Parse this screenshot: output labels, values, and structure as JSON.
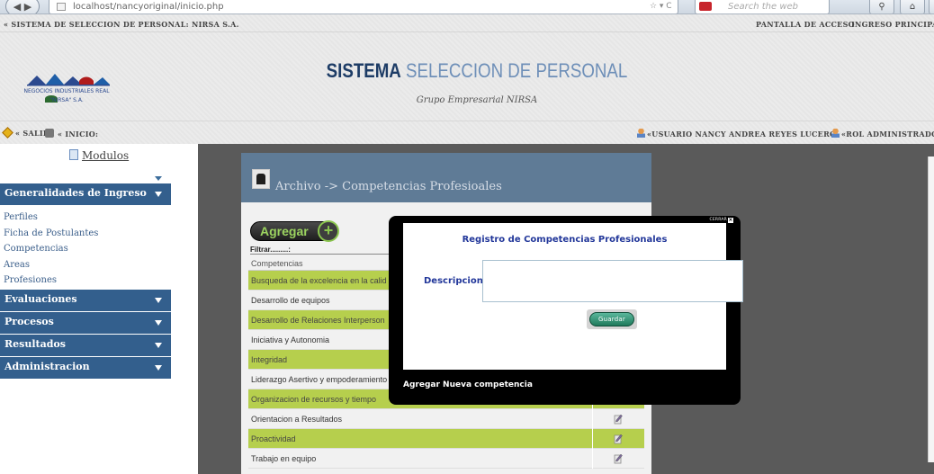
{
  "browser": {
    "url": "localhost/nancyoriginal/inicio.php",
    "search_placeholder": "Search the web"
  },
  "header": {
    "top_left": "« SISTEMA DE SELECCION DE PERSONAL: NIRSA S.A.",
    "pantalla_acceso": "PANTALLA DE ACCESO",
    "ingreso_principal": "INGRESO PRINCIPAL",
    "title_part1": "SISTEMA",
    "title_part2": " SELECCION DE PERSONAL",
    "subtitle": "Grupo Empresarial NIRSA",
    "logo_line1": "NEGOCIOS INDUSTRIALES REAL",
    "logo_line2": "\"NIRSA\" S.A.",
    "salir": "« SALIR:",
    "inicio": "« INICIO:",
    "usuario": "«USUARIO NANCY ANDREA REYES LUCERO",
    "rol": "«ROL ADMINISTRADOR"
  },
  "sidebar": {
    "modulos": "Modulos",
    "sections": [
      {
        "label": "Generalidades de Ingreso",
        "items": [
          "Perfiles",
          "Ficha de Postulantes",
          "Competencias",
          "Areas",
          "Profesiones"
        ]
      },
      {
        "label": "Evaluaciones"
      },
      {
        "label": "Procesos"
      },
      {
        "label": "Resultados"
      },
      {
        "label": "Administracion"
      }
    ]
  },
  "panel": {
    "title": "Archivo -> Competencias Profesioales",
    "add_button": "Agregar",
    "filter_label": "Filtrar.........:",
    "column_header": "Competencias",
    "rows": [
      "Busqueda de la excelencia en la calid",
      "Desarrollo de equipos",
      "Desarrollo de Relaciones Interperson",
      "Iniciativa y Autonomia",
      "Integridad",
      "Liderazgo Asertivo y empoderamiento",
      "Organizacion de recursos y tiempo",
      "Orientacion a Resultados",
      "Proactividad",
      "Trabajo en equipo"
    ]
  },
  "modal": {
    "close_label": "CERRAR",
    "title": "Registro de Competencias Profesionales",
    "desc_label": "Descripcion:",
    "desc_value": "",
    "save_button": "Guardar",
    "caption": "Agregar Nueva competencia"
  },
  "colors": {
    "accent_blue": "#335f8d",
    "row_green": "#b6cf4d",
    "modal_title": "#22379a"
  }
}
